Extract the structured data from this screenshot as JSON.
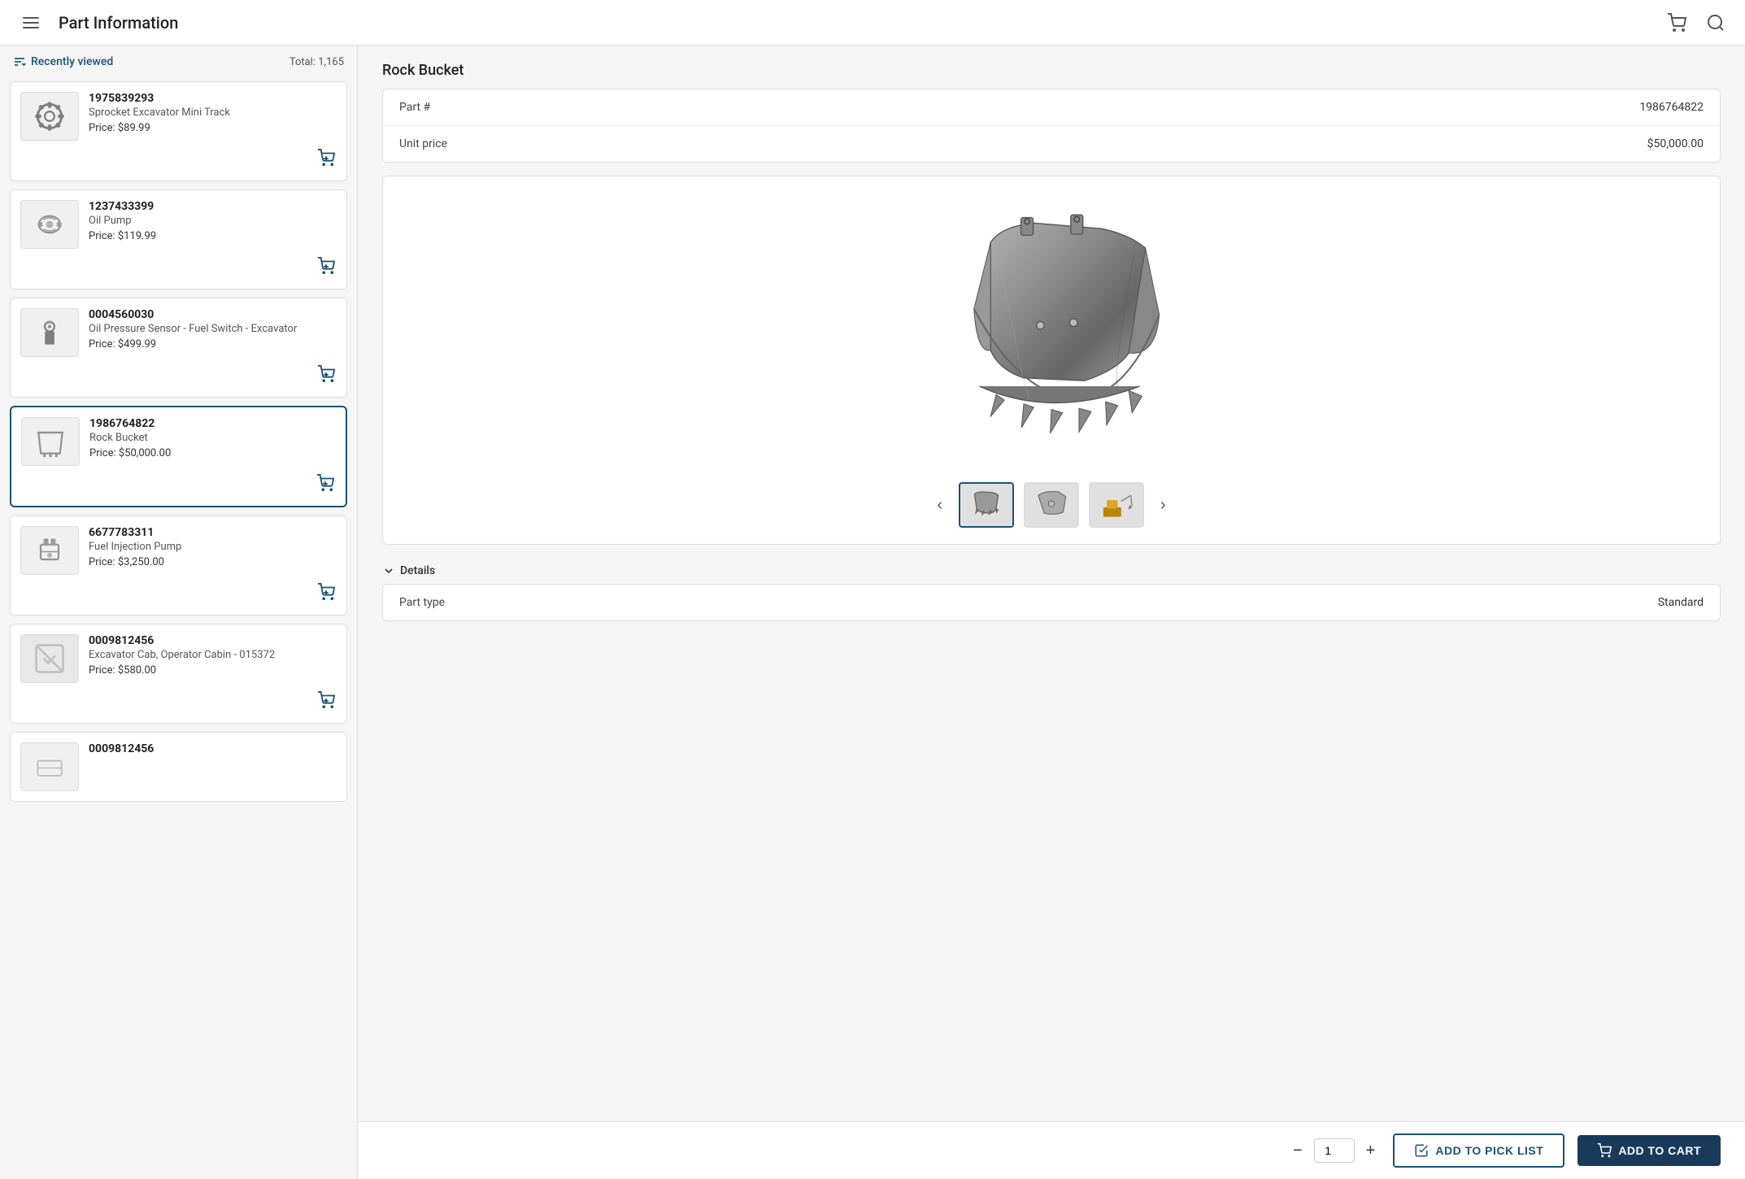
{
  "header": {
    "title": "Part Information",
    "menu_icon": "menu-icon",
    "cart_icon": "cart-icon",
    "search_icon": "search-icon"
  },
  "sidebar": {
    "recently_viewed_label": "Recently viewed",
    "total_label": "Total: 1,165",
    "items": [
      {
        "id": "1975839293",
        "number": "1975839293",
        "name": "Sprocket Excavator Mini Track",
        "price": "Price: $89.99",
        "active": false,
        "has_image": true,
        "image_type": "sprocket"
      },
      {
        "id": "1237433399",
        "number": "1237433399",
        "name": "Oil Pump",
        "price": "Price: $119.99",
        "active": false,
        "has_image": true,
        "image_type": "oil-pump"
      },
      {
        "id": "0004560030",
        "number": "0004560030",
        "name": "Oil Pressure Sensor - Fuel Switch - Excavator",
        "price": "Price: $499.99",
        "active": false,
        "has_image": true,
        "image_type": "sensor"
      },
      {
        "id": "1986764822",
        "number": "1986764822",
        "name": "Rock Bucket",
        "price": "Price: $50,000.00",
        "active": true,
        "has_image": true,
        "image_type": "bucket"
      },
      {
        "id": "6677783311",
        "number": "6677783311",
        "name": "Fuel Injection Pump",
        "price": "Price: $3,250.00",
        "active": false,
        "has_image": true,
        "image_type": "fuel-pump"
      },
      {
        "id": "0009812456a",
        "number": "0009812456",
        "name": "Excavator Cab, Operator Cabin - 015372",
        "price": "Price: $580.00",
        "active": false,
        "has_image": false,
        "image_type": "none"
      },
      {
        "id": "0009812456b",
        "number": "0009812456",
        "name": "",
        "price": "",
        "active": false,
        "has_image": true,
        "image_type": "generic"
      }
    ]
  },
  "product": {
    "title": "Rock Bucket",
    "part_number_label": "Part #",
    "part_number_value": "1986764822",
    "unit_price_label": "Unit price",
    "unit_price_value": "$50,000.00",
    "details_label": "Details",
    "part_type_label": "Part type",
    "part_type_value": "Standard"
  },
  "gallery": {
    "thumbnails": [
      {
        "id": "t1",
        "active": true
      },
      {
        "id": "t2",
        "active": false
      },
      {
        "id": "t3",
        "active": false
      }
    ]
  },
  "actions": {
    "quantity": "1",
    "pick_list_label": "ADD TO PICK LIST",
    "add_cart_label": "ADD TO CART"
  }
}
